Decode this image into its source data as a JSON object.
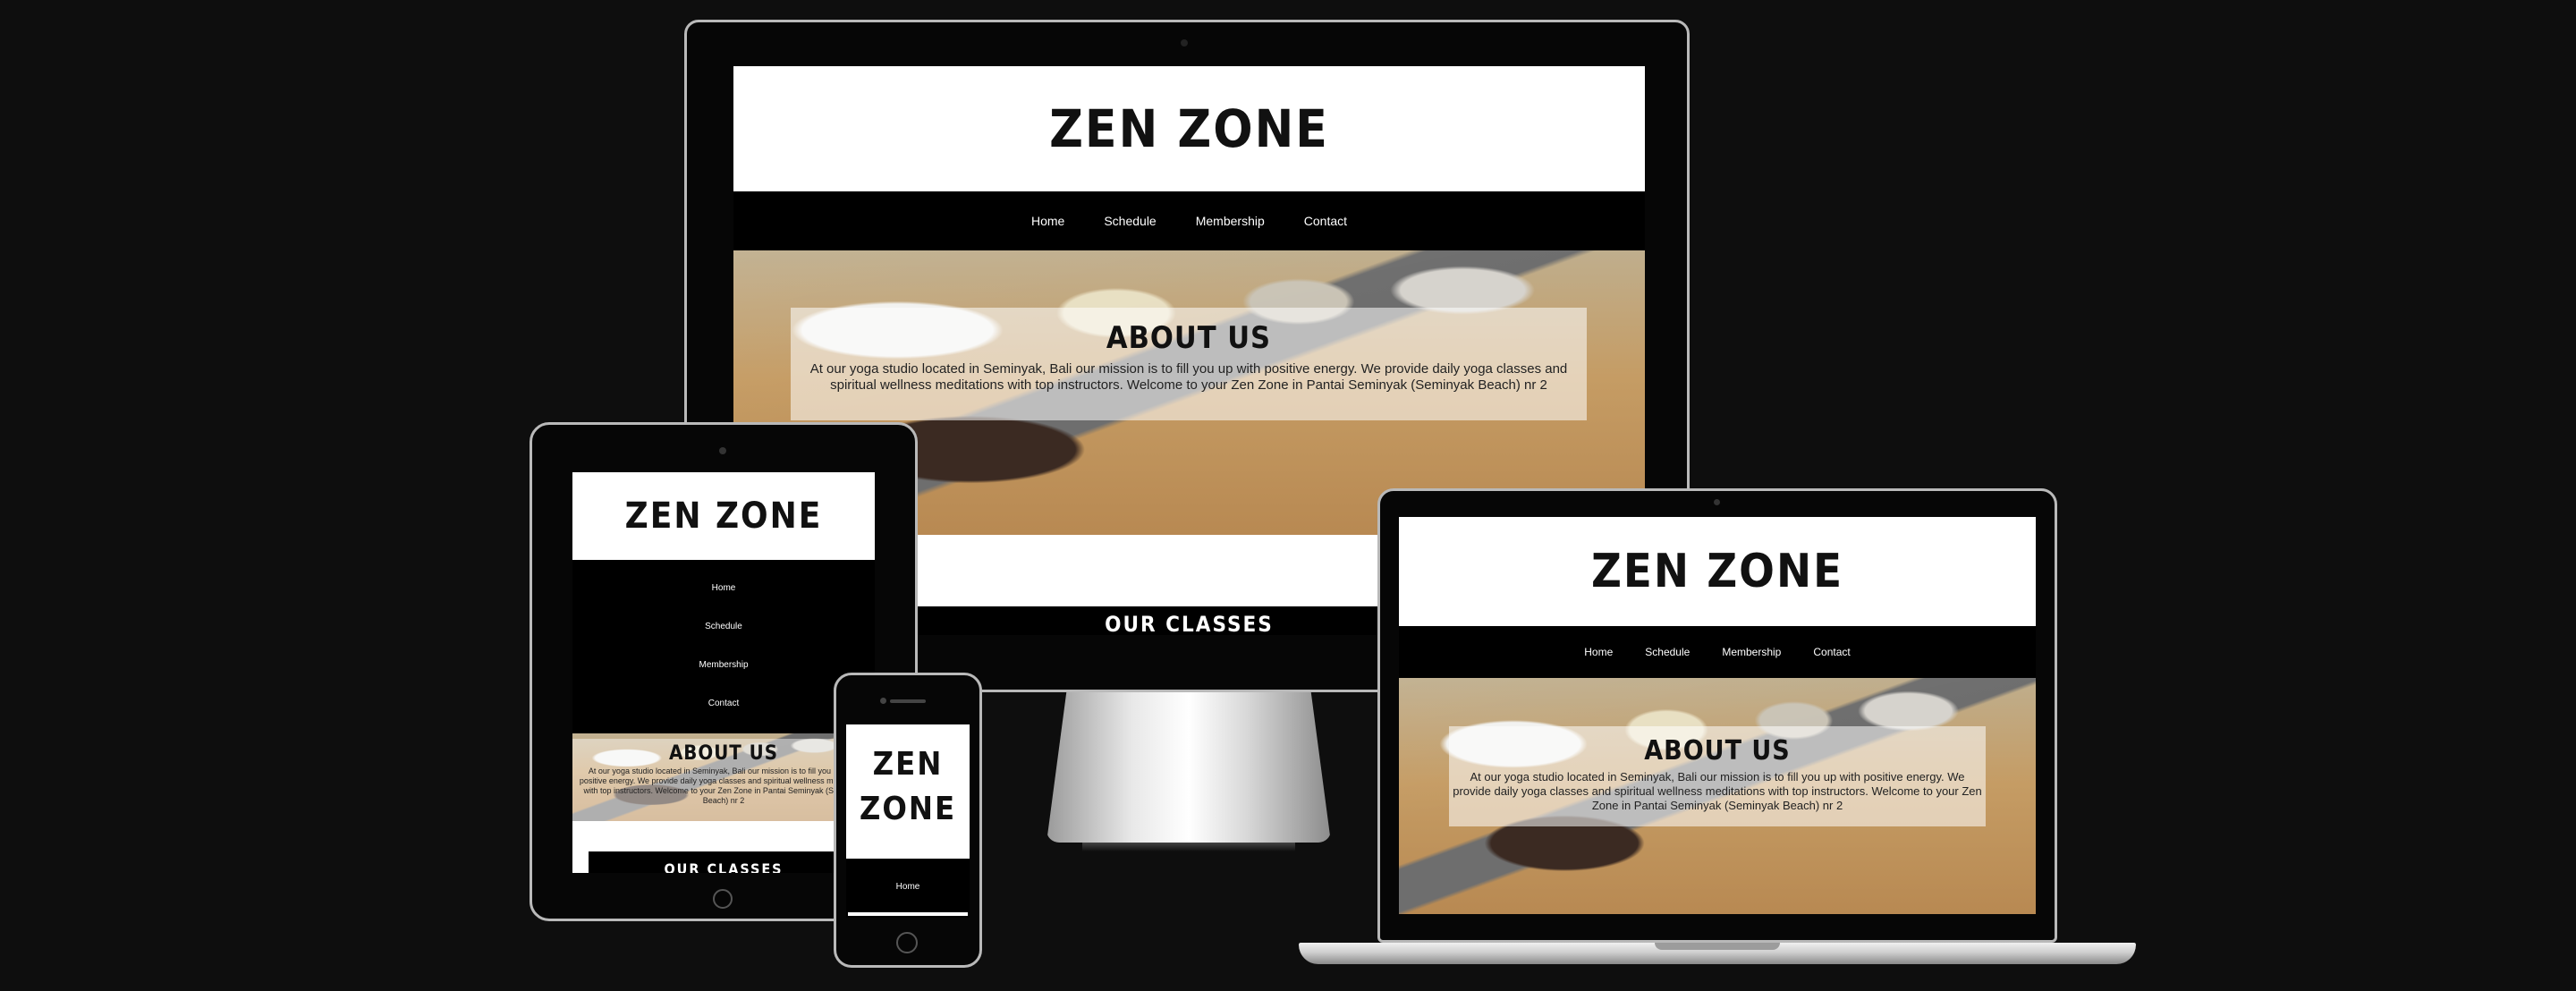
{
  "site": {
    "brand": "ZEN ZONE",
    "brand_line1": "ZEN",
    "brand_line2": "ZONE",
    "nav": [
      "Home",
      "Schedule",
      "Membership",
      "Contact"
    ],
    "about_title": "ABOUT US",
    "about_text": "At our yoga studio located in Seminyak, Bali our mission is to fill you up with positive energy. We provide daily yoga classes and spiritual wellness meditations with top instructors. Welcome to your Zen Zone in Pantai Seminyak (Seminyak Beach) nr 2",
    "about_text_laptop": "At our yoga studio located in Seminyak, Bali our mission is to fill you up with positive energy. We provide daily yoga classes and spiritual wellness meditations with top instructors. Welcome to your Zen Zone in Pantai Seminyak (Seminyak Beach) nr 2",
    "about_text_tablet": "At our yoga studio located in Seminyak, Bali our mission is to fill you up with positive energy. We provide daily yoga classes and spiritual wellness meditations with top instructors. Welcome to your Zen Zone in Pantai Seminyak (Seminyak Beach) nr 2",
    "classes_title": "OUR CLASSES"
  },
  "colors": {
    "background": "#0e0e0e",
    "header_bg": "#ffffff",
    "nav_bg": "#000000",
    "device_frame": "#b9b9b9"
  }
}
